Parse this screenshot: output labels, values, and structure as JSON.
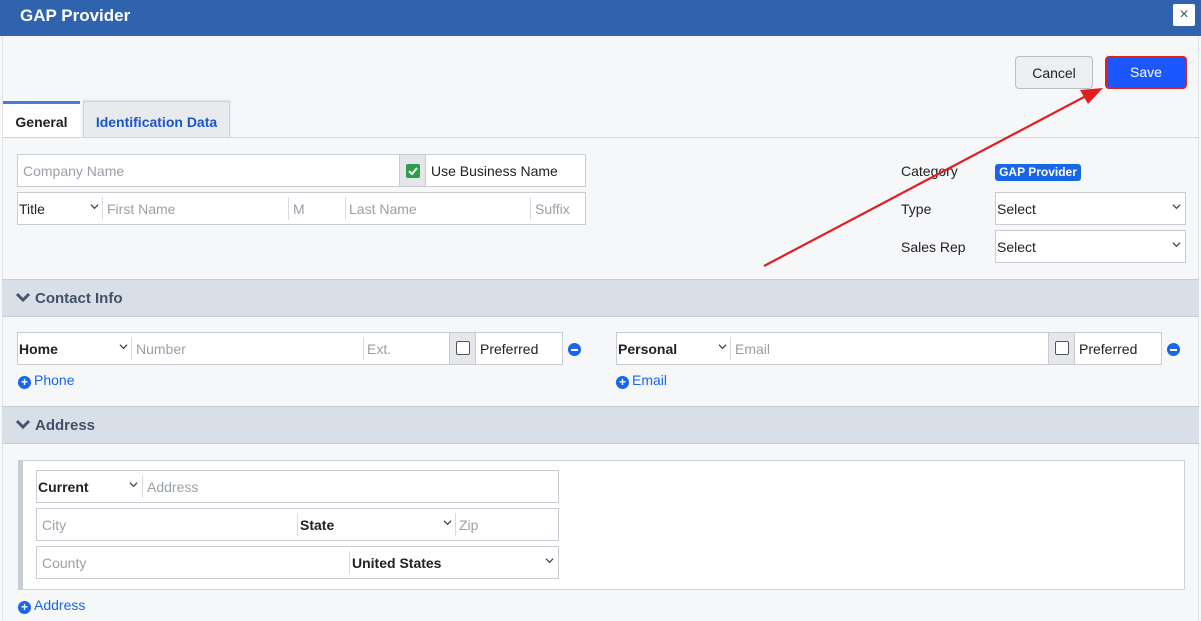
{
  "window": {
    "title": "GAP Provider",
    "close_glyph": "×"
  },
  "toolbar": {
    "cancel_label": "Cancel",
    "save_label": "Save"
  },
  "tabs": [
    {
      "label": "General"
    },
    {
      "label": "Identification Data"
    }
  ],
  "general": {
    "company_name_placeholder": "Company Name",
    "use_business_name_label": "Use Business Name",
    "use_business_name_checked": true,
    "title_value": "Title",
    "first_name_placeholder": "First Name",
    "middle_placeholder": "M",
    "last_name_placeholder": "Last Name",
    "suffix_placeholder": "Suffix",
    "category_label": "Category",
    "category_value": "GAP Provider",
    "type_label": "Type",
    "type_value": "Select",
    "sales_rep_label": "Sales Rep",
    "sales_rep_value": "Select"
  },
  "contact_info": {
    "title": "Contact Info",
    "phone": {
      "type": "Home",
      "number_placeholder": "Number",
      "ext_placeholder": "Ext.",
      "preferred_label": "Preferred",
      "add_label": "Phone"
    },
    "email": {
      "type": "Personal",
      "email_placeholder": "Email",
      "preferred_label": "Preferred",
      "add_label": "Email"
    }
  },
  "address": {
    "title": "Address",
    "type": "Current",
    "address_placeholder": "Address",
    "city_placeholder": "City",
    "state_value": "State",
    "zip_placeholder": "Zip",
    "county_placeholder": "County",
    "country_value": "United States",
    "add_label": "Address"
  },
  "colors": {
    "titlebar": "#2f63ad",
    "save_button": "#1a57ff",
    "annotation_arrow": "#e02020",
    "link": "#1a66e8"
  }
}
